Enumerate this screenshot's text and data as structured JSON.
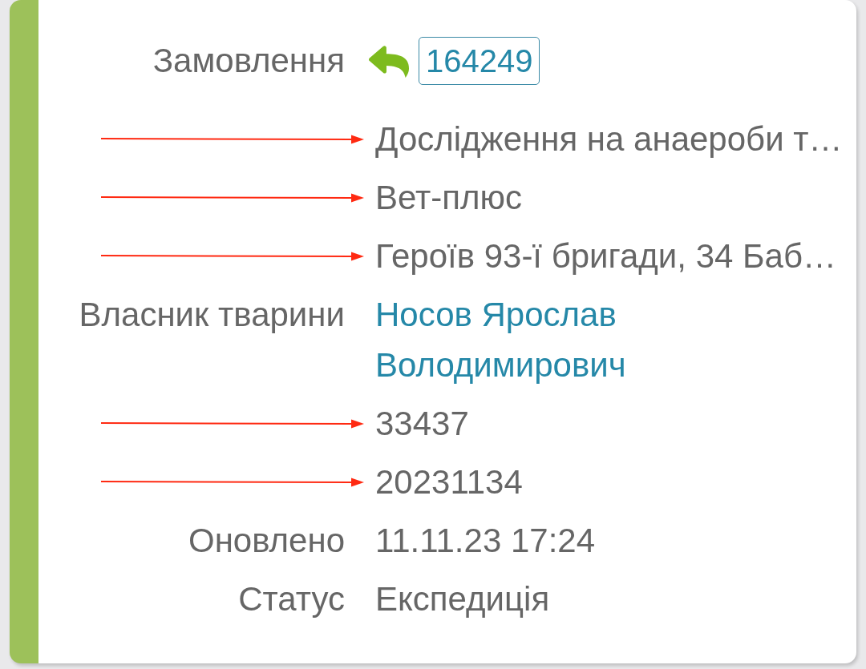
{
  "rows": [
    {
      "kind": "order",
      "label": "Замовлення",
      "arrow": false,
      "value": "164249"
    },
    {
      "kind": "text",
      "arrow": true,
      "value": "Дослідження на анаероби т…"
    },
    {
      "kind": "text",
      "arrow": true,
      "value": "Вет-плюс"
    },
    {
      "kind": "text",
      "arrow": true,
      "value": "Героїв 93-ї бригади, 34 Баб…"
    },
    {
      "kind": "link",
      "label": "Власник тварини",
      "arrow": false,
      "value": "Носов Ярослав Володимирович"
    },
    {
      "kind": "text",
      "arrow": true,
      "value": "33437"
    },
    {
      "kind": "text",
      "arrow": true,
      "value": "20231134"
    },
    {
      "kind": "text",
      "label": "Оновлено",
      "arrow": false,
      "value": "11.11.23 17:24"
    },
    {
      "kind": "text",
      "label": "Статус",
      "arrow": false,
      "value": "Експедиція"
    }
  ]
}
